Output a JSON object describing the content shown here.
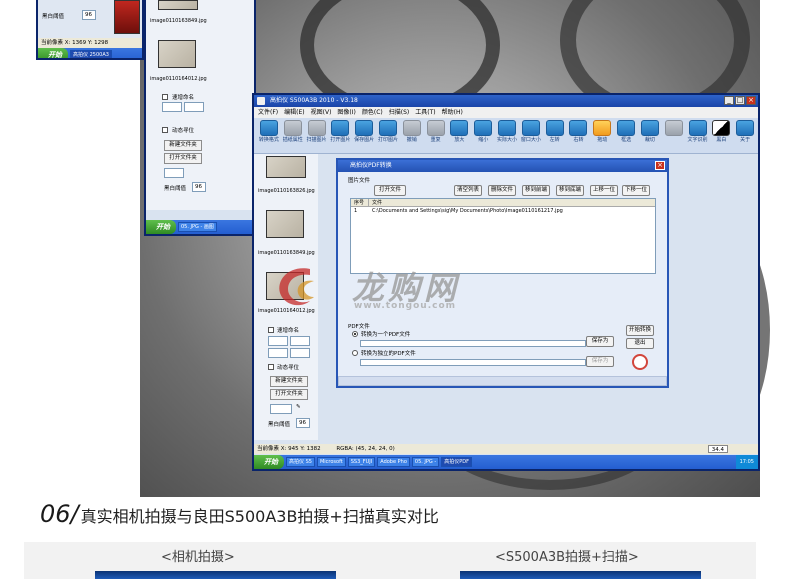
{
  "back_window_left": {
    "status": "当前像素 X: 1369 Y: 1298",
    "status_right": "RGBA: (5",
    "bw_label": "黑白阈值",
    "bw_value": "96",
    "start": "开始",
    "task": "高拍仪 2500A3"
  },
  "back_window_mid": {
    "thumbs": [
      "image0110163849.jpg",
      "image0110164012.jpg"
    ],
    "auto_name": "速增命名",
    "dynamic_save": "动态寻位",
    "new_folder": "新建文件夹",
    "open_folder": "打开文件夹",
    "bw_label": "黑白阈值",
    "bw_value": "96",
    "start": "开始",
    "task": "05. JPG - 画图"
  },
  "main_window": {
    "title": "高拍仪 S500A3B 2010 - V3.18",
    "menu": [
      "文件(F)",
      "编辑(E)",
      "视图(V)",
      "图像(I)",
      "颜色(C)",
      "扫描(S)",
      "工具(T)",
      "帮助(H)"
    ],
    "toolbar": [
      "转换格式",
      "插纸属性",
      "扫描图片",
      "打开图片",
      "保存图片",
      "打印图片",
      "撤销",
      "重复",
      "放大",
      "缩小",
      "实际大小",
      "窗口大小",
      "左转",
      "右转",
      "拖动",
      "框选",
      "裁切",
      "",
      "文字识别",
      "黑白",
      "关于"
    ],
    "thumbs": [
      "image0110163826.jpg",
      "image0110163849.jpg",
      "image0110164012.jpg"
    ],
    "auto_name": "速增命名",
    "dynamic_save": "动态寻位",
    "new_folder": "新建文件夹",
    "open_folder": "打开文件夹",
    "bw_label": "黑白阈值",
    "bw_value": "96",
    "status": "当前像素 X: 945 Y: 1382",
    "status_rgba": "RGBA: (45, 24, 24, 0)",
    "zoom": "34.4",
    "start": "开始",
    "tasks": [
      "高拍仪 S5",
      "Microsoft",
      "SS3_FUJI",
      "Adobe Pho",
      "05. JPG -",
      "高拍仪PDF"
    ],
    "clock": "17:05"
  },
  "pdf_dialog": {
    "title": "高拍仪PDF转换",
    "group_images": "图片文件",
    "open_file": "打开文件",
    "clear_list": "清空列表",
    "delete_file": "删除文件",
    "remove_selected": "移到前端",
    "move_end": "移到底端",
    "up": "上移一位",
    "down": "下移一位",
    "col_no": "序号",
    "col_file": "文件",
    "rows": [
      {
        "no": "1",
        "file": "C:\\Documents and Settings\\sig\\My Documents\\Photo\\Image0110161217.jpg"
      }
    ],
    "group_pdf": "PDF文件",
    "opt_single": "转换为一个PDF文件",
    "opt_multi": "转换为独立的PDF文件",
    "save_as": "保存为",
    "save_as2": "保存为",
    "start_convert": "开始转换",
    "exit": "退出"
  },
  "watermark": {
    "cn": "龙购网",
    "url": "www.tongou.com"
  },
  "section": {
    "number": "06/",
    "title": "真实相机拍摄与良田S500A3B拍摄+扫描真实对比",
    "left_caption": "<相机拍摄>",
    "right_caption": "<S500A3B拍摄+扫描>"
  }
}
